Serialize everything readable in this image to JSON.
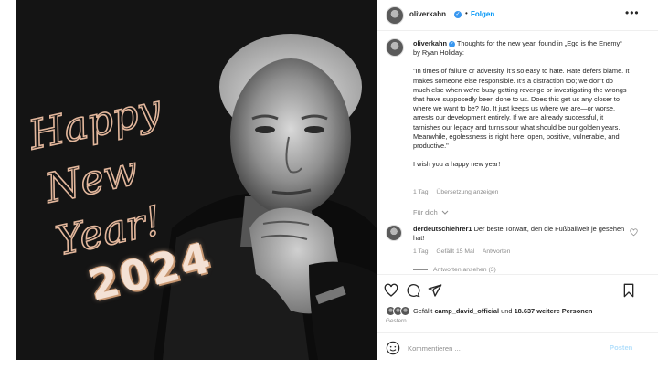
{
  "photo": {
    "greeting_lines": [
      "Happy",
      "New",
      "Year!"
    ],
    "year": "2024",
    "script_color": "#e3b79c",
    "background": "#141414"
  },
  "header": {
    "username": "oliverkahn",
    "separator": "•",
    "follow_label": "Folgen",
    "more_icon": "ellipsis-icon",
    "accent": "#0095f6"
  },
  "caption": {
    "username": "oliverkahn",
    "intro": "Thoughts for the new year, found in „Ego is the Enemy“ by Ryan Holiday:",
    "quote": "\"In times of failure or adversity, it's so easy to hate. Hate defers blame. It makes someone else responsible. It's a distraction too; we don't do much else when we're busy getting revenge or investigating the wrongs that have supposedly been done to us. Does this get us any closer to where we want to be? No. It just keeps us where we are—or worse, arrests our development entirely. If we are already successful, it tarnishes our legacy and turns sour what should be our golden years. Meanwhile, egolessness is right here; open, positive, vulnerable, and productive.\"",
    "closing": "I wish you a happy new year!",
    "age": "1 Tag",
    "translate_label": "Übersetzung anzeigen"
  },
  "for_you_label": "Für dich",
  "comment": {
    "username": "derdeutschlehrer1",
    "text": "Der beste Torwart, den die Fußballwelt je gesehen hat!",
    "age": "1 Tag",
    "likes": "Gefällt 15 Mal",
    "reply_label": "Antworten",
    "view_replies": "Antworten ansehen (3)"
  },
  "action_icons": [
    "heart-icon",
    "comment-icon",
    "share-icon",
    "bookmark-icon"
  ],
  "likes": {
    "prefix": "Gefällt",
    "liked_by": "camp_david_official",
    "connector": "und",
    "others": "18.637 weitere Personen"
  },
  "date": "Gestern",
  "composer": {
    "placeholder": "Kommentieren ...",
    "post_label": "Posten",
    "post_color": "#b2dffc"
  }
}
